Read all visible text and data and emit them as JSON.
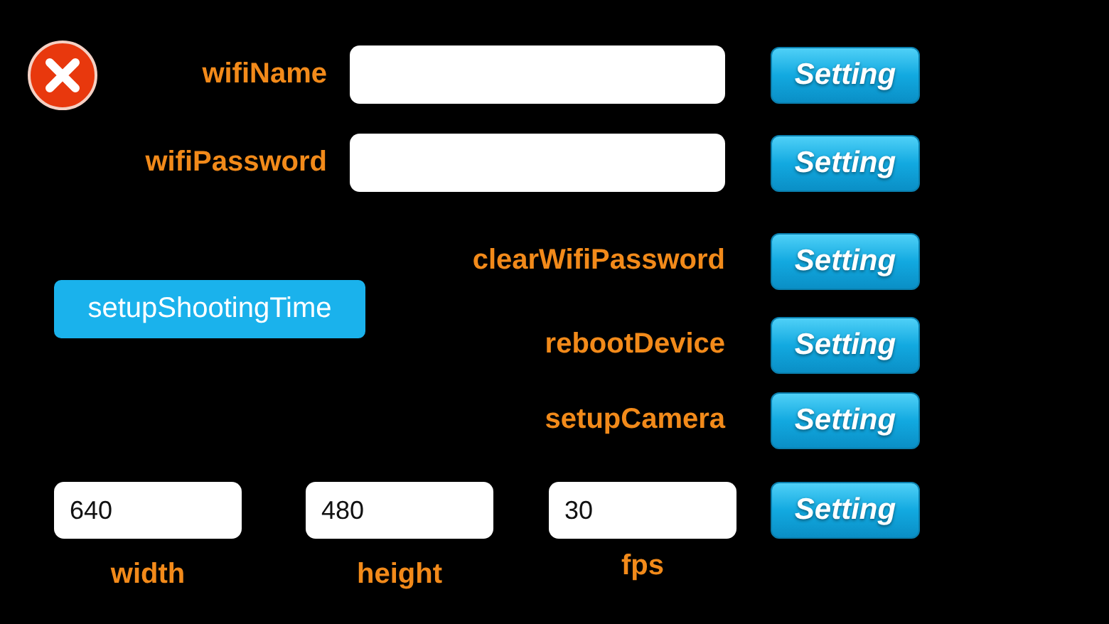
{
  "wifi_fields": [
    {
      "label": "wifiName",
      "button": "Setting"
    },
    {
      "label": "wifiPassword",
      "button": "Setting"
    }
  ],
  "shooting_time_button": "setupShootingTime",
  "actions": [
    {
      "label": "clearWifiPassword",
      "button": "Setting"
    },
    {
      "label": "rebootDevice",
      "button": "Setting"
    },
    {
      "label": "setupCamera",
      "button": "Setting"
    }
  ],
  "camera": {
    "fields": [
      {
        "label": "width",
        "value": "640"
      },
      {
        "label": "height",
        "value": "480"
      },
      {
        "label": "fps",
        "value": "30"
      }
    ],
    "button": "Setting"
  }
}
